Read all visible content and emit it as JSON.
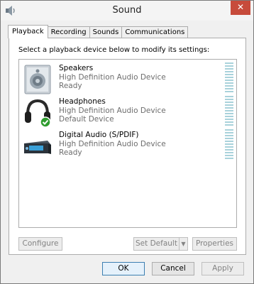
{
  "window": {
    "title": "Sound",
    "close_glyph": "✕"
  },
  "tabs": [
    {
      "label": "Playback",
      "active": true
    },
    {
      "label": "Recording",
      "active": false
    },
    {
      "label": "Sounds",
      "active": false
    },
    {
      "label": "Communications",
      "active": false
    }
  ],
  "panel": {
    "instruction": "Select a playback device below to modify its settings:",
    "devices": [
      {
        "name": "Speakers",
        "line1": "High Definition Audio Device",
        "line2": "Ready",
        "icon": "speaker-icon"
      },
      {
        "name": "Headphones",
        "line1": "High Definition Audio Device",
        "line2": "Default Device",
        "icon": "headphones-icon",
        "default_check": true
      },
      {
        "name": "Digital Audio (S/PDIF)",
        "line1": "High Definition Audio Device",
        "line2": "Ready",
        "icon": "digital-audio-icon"
      }
    ],
    "buttons": {
      "configure": "Configure",
      "set_default": "Set Default",
      "properties": "Properties"
    }
  },
  "footer": {
    "ok": "OK",
    "cancel": "Cancel",
    "apply": "Apply"
  },
  "colors": {
    "meter": "#a9d2db",
    "close": "#c74b3b",
    "check": "#2e9c2e"
  }
}
